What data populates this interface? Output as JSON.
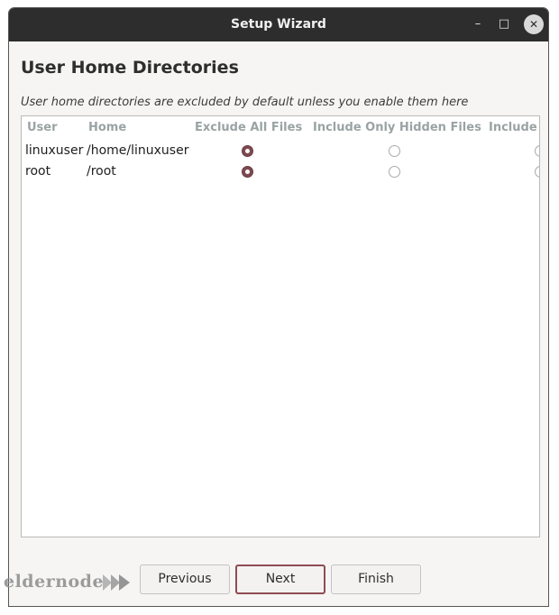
{
  "window": {
    "title": "Setup Wizard",
    "controls": {
      "minimize": "–",
      "maximize": "□",
      "close": "✕"
    }
  },
  "page": {
    "heading": "User Home Directories",
    "description": "User home directories are excluded by default unless you enable them here"
  },
  "table": {
    "columns": [
      "User",
      "Home",
      "Exclude All Files",
      "Include Only Hidden Files",
      "Include"
    ],
    "rows": [
      {
        "user": "linuxuser",
        "home": "/home/linuxuser",
        "selected": "Exclude All Files"
      },
      {
        "user": "root",
        "home": "/root",
        "selected": "Exclude All Files"
      }
    ]
  },
  "buttons": {
    "previous": "Previous",
    "next": "Next",
    "finish": "Finish"
  },
  "watermark": {
    "text": "eldernode"
  }
}
